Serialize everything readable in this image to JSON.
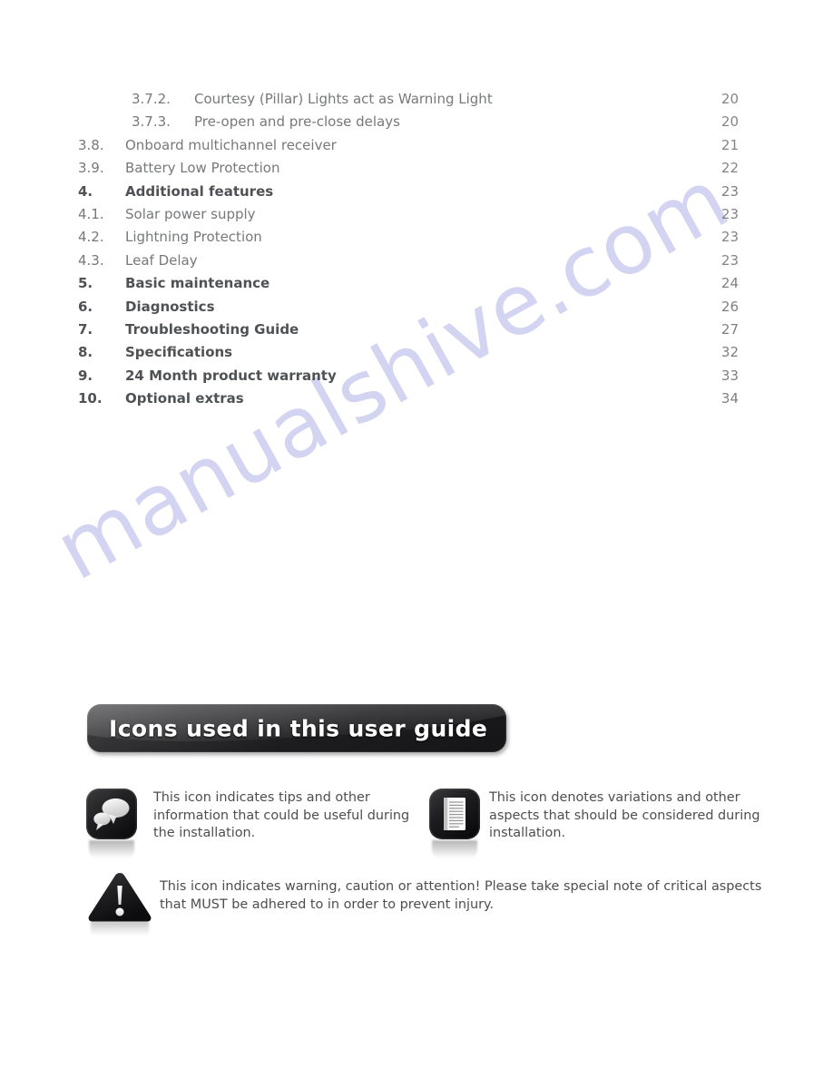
{
  "watermark": {
    "text": "manualshive.com",
    "color": "#ccccf0"
  },
  "toc": {
    "entries": [
      {
        "number": "3.7.2.",
        "label": "Courtesy (Pillar) Lights act as Warning Light",
        "page": "20",
        "level": 3,
        "bold": false
      },
      {
        "number": "3.7.3.",
        "label": "Pre-open and pre-close delays",
        "page": "20",
        "level": 3,
        "bold": false
      },
      {
        "number": "3.8.",
        "label": "Onboard multichannel receiver",
        "page": "21",
        "level": 2,
        "bold": false
      },
      {
        "number": "3.9.",
        "label": "Battery Low Protection",
        "page": "22",
        "level": 2,
        "bold": false
      },
      {
        "number": "4.",
        "label": "Additional features",
        "page": "23",
        "level": 2,
        "bold": true
      },
      {
        "number": "4.1.",
        "label": "Solar power supply",
        "page": "23",
        "level": 2,
        "bold": false
      },
      {
        "number": "4.2.",
        "label": "Lightning Protection",
        "page": "23",
        "level": 2,
        "bold": false
      },
      {
        "number": "4.3.",
        "label": "Leaf Delay",
        "page": "23",
        "level": 2,
        "bold": false
      },
      {
        "number": "5.",
        "label": "Basic maintenance",
        "page": "24",
        "level": 2,
        "bold": true
      },
      {
        "number": "6.",
        "label": "Diagnostics",
        "page": "26",
        "level": 2,
        "bold": true
      },
      {
        "number": "7.",
        "label": "Troubleshooting Guide",
        "page": "27",
        "level": 2,
        "bold": true
      },
      {
        "number": "8.",
        "label": "Specifications",
        "page": "32",
        "level": 2,
        "bold": true
      },
      {
        "number": "9.",
        "label": "24 Month product warranty",
        "page": "33",
        "level": 2,
        "bold": true
      },
      {
        "number": "10.",
        "label": "Optional extras",
        "page": "34",
        "level": 2,
        "bold": true
      }
    ]
  },
  "banner": {
    "title": "Icons used in this user guide",
    "background_color": "#262628",
    "text_color": "#ffffff"
  },
  "legend": {
    "tip": {
      "icon": "speech-bubbles-icon",
      "text": "This icon indicates tips and other information that could be useful during the installation."
    },
    "note": {
      "icon": "document-lines-icon",
      "text": "This icon denotes variations and other aspects that should be considered during installation."
    },
    "warning": {
      "icon": "warning-triangle-icon",
      "text": "This icon indicates warning, caution or attention! Please take special note of critical aspects that MUST be adhered to in order to prevent injury."
    }
  }
}
